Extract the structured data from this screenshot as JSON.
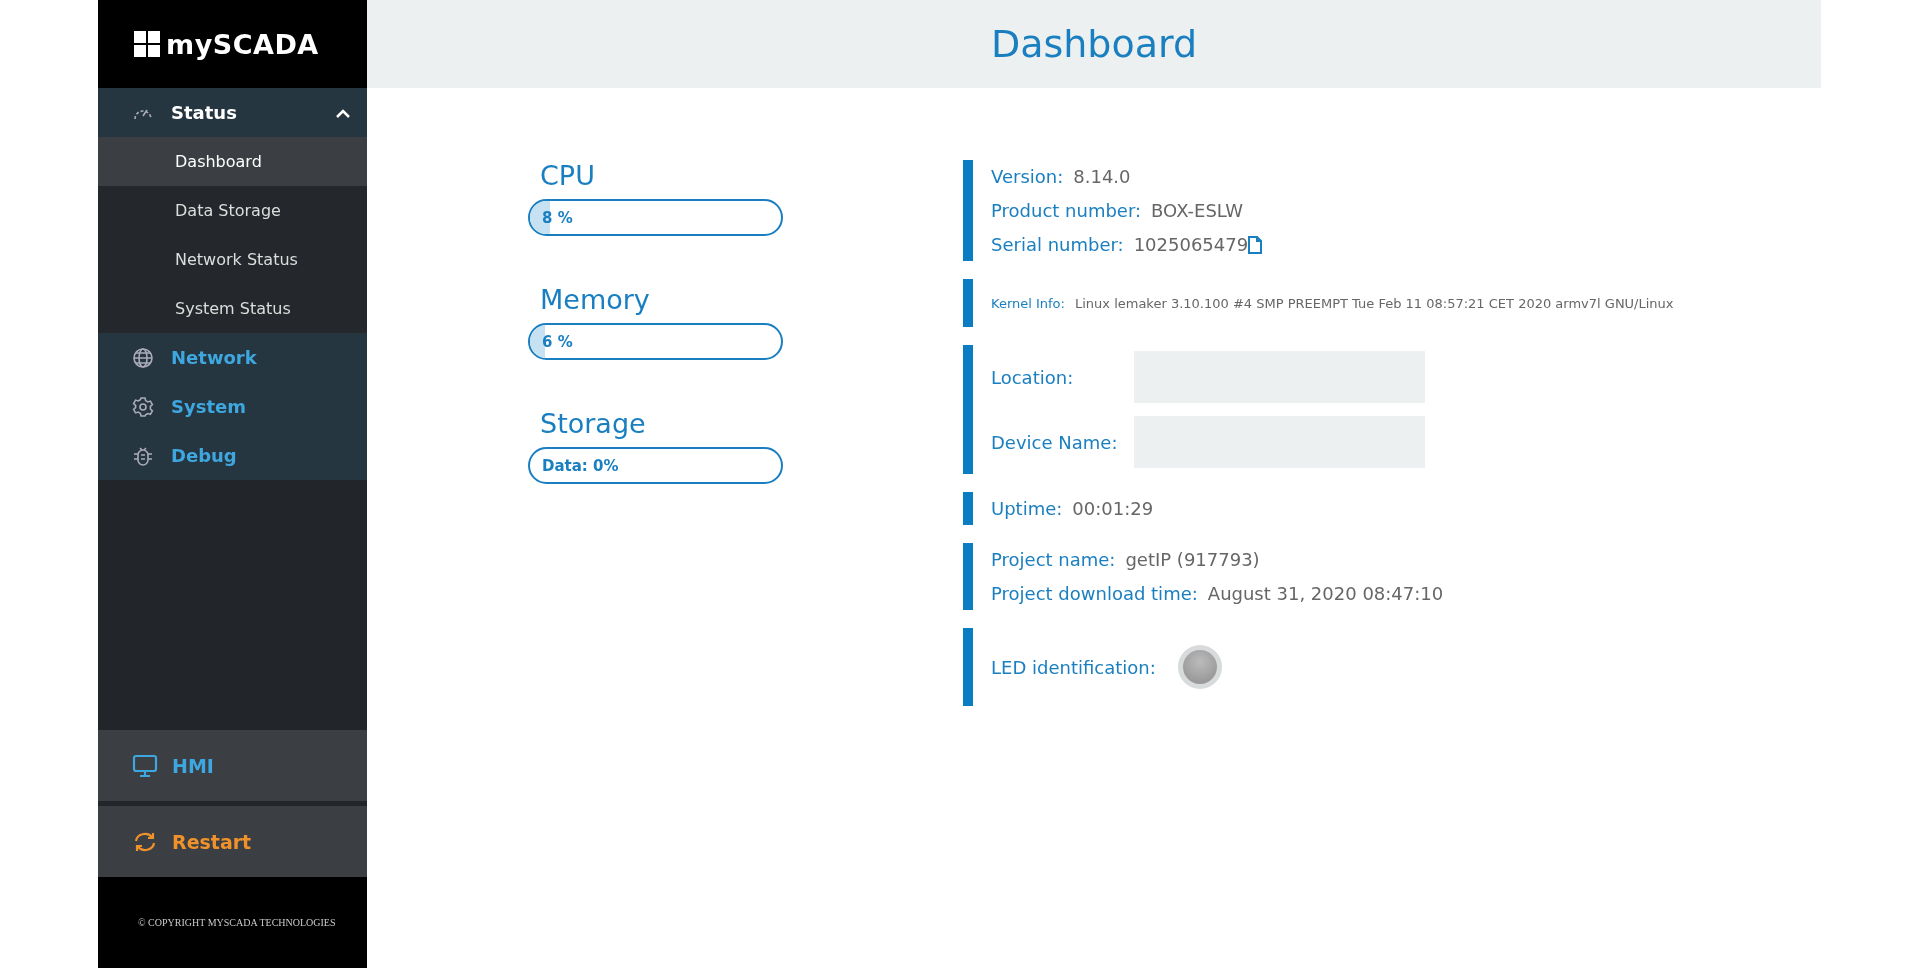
{
  "logo": {
    "text": "mySCADA"
  },
  "sidebar": {
    "items": [
      {
        "label": "Status",
        "expanded": true,
        "children": [
          {
            "label": "Dashboard",
            "selected": true
          },
          {
            "label": "Data Storage",
            "selected": false
          },
          {
            "label": "Network Status",
            "selected": false
          },
          {
            "label": "System Status",
            "selected": false
          }
        ]
      },
      {
        "label": "Network",
        "expanded": false
      },
      {
        "label": "System",
        "expanded": false
      },
      {
        "label": "Debug",
        "expanded": false
      }
    ],
    "bottom": [
      {
        "kind": "hmi",
        "label": "HMI"
      },
      {
        "kind": "restart",
        "label": "Restart"
      }
    ],
    "copyright": "© COPYRIGHT MYSCADA TECHNOLOGIES"
  },
  "header": {
    "title": "Dashboard"
  },
  "gauges": [
    {
      "label": "CPU",
      "reading": "8 %",
      "level": 0.08
    },
    {
      "label": "Memory",
      "reading": "6 %",
      "level": 0.06
    },
    {
      "label": "Storage",
      "reading": "Data: 0%",
      "level": 0
    }
  ],
  "info_groups": [
    {
      "rows": [
        {
          "kind": "text",
          "label": "Version:",
          "value": "8.14.0"
        },
        {
          "kind": "text",
          "label": "Product number:",
          "value": "BOX-ESLW"
        },
        {
          "kind": "copy",
          "label": "Serial number:",
          "value": "1025065479"
        }
      ]
    },
    {
      "rows": [
        {
          "kind": "small",
          "label": "Kernel Info:",
          "value": "Linux lemaker 3.10.100 #4 SMP PREEMPT Tue Feb 11 08:57:21 CET 2020 armv7l GNU/Linux"
        }
      ]
    },
    {
      "rows": [
        {
          "kind": "input",
          "label": "Location:"
        },
        {
          "kind": "input",
          "label": "Device Name:"
        }
      ]
    },
    {
      "rows": [
        {
          "kind": "text",
          "label": "Uptime:",
          "value": "00:01:29"
        }
      ]
    },
    {
      "rows": [
        {
          "kind": "text",
          "label": "Project name:",
          "value": "getIP (917793)"
        },
        {
          "kind": "text",
          "label": "Project download time:",
          "value": "August 31, 2020 08:47:10"
        }
      ]
    },
    {
      "rows": [
        {
          "kind": "led",
          "label": "LED identification:",
          "on": false
        }
      ]
    }
  ]
}
